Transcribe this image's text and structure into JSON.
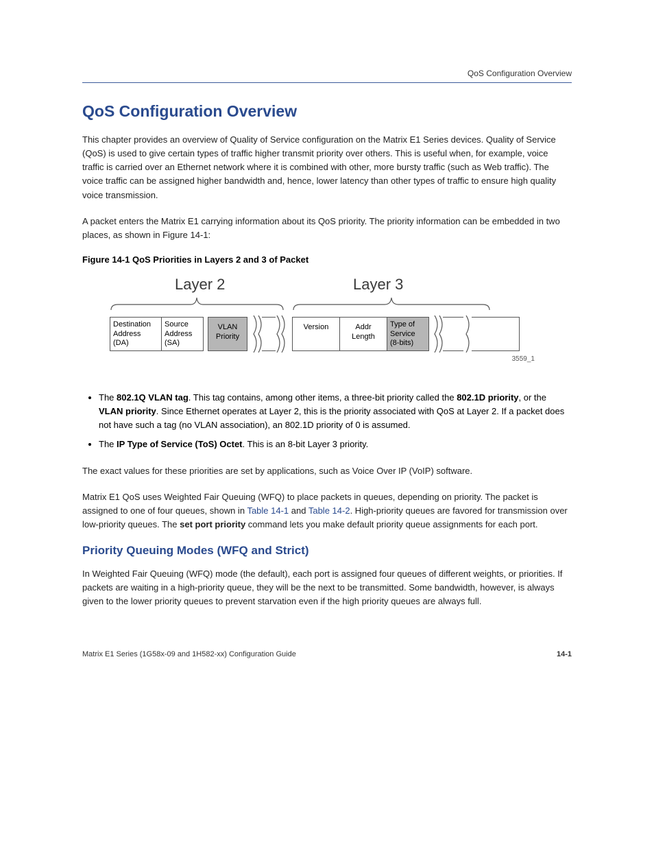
{
  "crumb": "QoS Configuration Overview",
  "title": "QoS Configuration Overview",
  "intro_p1": "This chapter provides an overview of Quality of Service configuration on the Matrix E1 Series devices. Quality of Service (QoS) is used to give certain types of traffic higher transmit priority over others. This is useful when, for example, voice traffic is carried over an Ethernet network where it is combined with other, more bursty traffic (such as Web traffic). The voice traffic can be assigned higher bandwidth and, hence, lower latency than other types of traffic to ensure high quality voice transmission.",
  "intro_p2": "A packet enters the Matrix E1 carrying information about its QoS priority. The priority information can be embedded in two places, as shown in Figure 14-1:",
  "fig_caption": "Figure 14-1  QoS Priorities in Layers 2 and 3 of Packet",
  "layer2_label": "Layer 2",
  "layer3_label": "Layer 3",
  "cells": {
    "da": "Destination\nAddress\n(DA)",
    "sa": "Source\nAddress\n(SA)",
    "vlan": "VLAN\nPriority",
    "ver": "Version",
    "addrlen": "Addr\nLength",
    "tos": "Type of\nService\n(8-bits)"
  },
  "fig_id": "3559_1",
  "bullet1_a": "The ",
  "bullet1_b": "802.1Q VLAN tag",
  "bullet1_c": ". This tag contains, among other items, a three-bit priority called the ",
  "bullet1_d": "802.1D priority",
  "bullet1_e": ", or the ",
  "bullet1_f": "VLAN priority",
  "bullet1_g": ". Since Ethernet operates at Layer 2, this is the priority associated with QoS at Layer 2. If a packet does not have such a tag (no VLAN association), an 802.1D priority of 0 is assumed.",
  "bullet2_a": "The ",
  "bullet2_b": "IP Type of Service (ToS) Octet",
  "bullet2_c": ". This is an 8-bit Layer 3 priority.",
  "para_after_bullets": "The exact values for these priorities are set by applications, such as Voice Over IP (VoIP) software.",
  "para2_a": "Matrix E1 QoS uses Weighted Fair Queuing (WFQ) to place packets in queues, depending on priority. The packet is assigned to one of four queues, shown in ",
  "para2_b": "Table 14-1",
  "para2_c": " and ",
  "para2_d": "Table 14-2",
  "para2_e": ". High-priority queues are favored for transmission over low-priority queues. The ",
  "para2_f": "set port priority",
  "para2_g": " command lets you make default priority queue assignments for each port.",
  "sub_heading": "Priority Queuing Modes (WFQ and Strict)",
  "para3": "In Weighted Fair Queuing (WFQ) mode (the default), each port is assigned four queues of different weights, or priorities. If packets are waiting in a high-priority queue, they will be the next to be transmitted. Some bandwidth, however, is always given to the lower priority queues to prevent starvation even if the high priority queues are always full.",
  "footer": "Matrix E1 Series (1G58x-09 and 1H582-xx) Configuration Guide",
  "page_num": "14-1"
}
